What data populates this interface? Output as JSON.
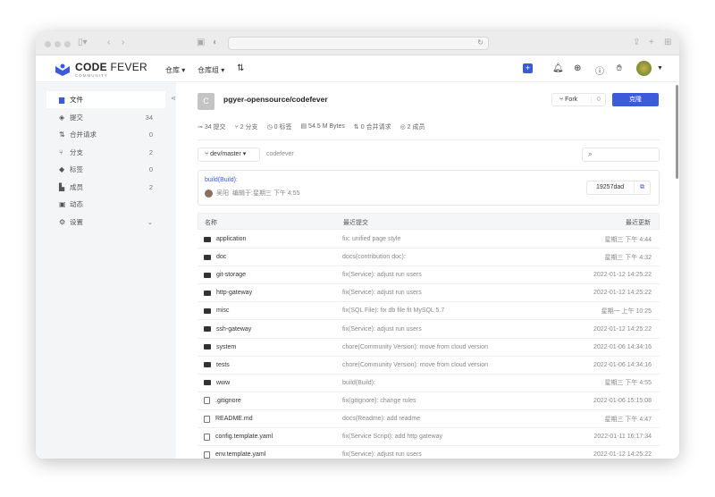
{
  "app": {
    "logo_main": "CODE",
    "logo_accent": "FEVER",
    "logo_sub": "COMMUNITY"
  },
  "header": {
    "nav": [
      {
        "label": "仓库"
      },
      {
        "label": "仓库组"
      }
    ],
    "icons": [
      "plus-icon",
      "bell-icon",
      "globe-icon",
      "help-icon",
      "hand-icon",
      "avatar"
    ]
  },
  "sidebar": {
    "items": [
      {
        "label": "文件",
        "icon": "file-icon",
        "count": ""
      },
      {
        "label": "提交",
        "icon": "commit-icon",
        "count": "34"
      },
      {
        "label": "合并请求",
        "icon": "merge-request-icon",
        "count": "0"
      },
      {
        "label": "分支",
        "icon": "branch-icon",
        "count": "2"
      },
      {
        "label": "标签",
        "icon": "tag-icon",
        "count": "0"
      },
      {
        "label": "成员",
        "icon": "members-icon",
        "count": "2"
      },
      {
        "label": "动态",
        "icon": "activity-icon",
        "count": ""
      },
      {
        "label": "设置",
        "icon": "gear-icon",
        "count": ""
      }
    ]
  },
  "repo": {
    "avatar_letter": "C",
    "name": "pgyer-opensource/codefever",
    "fork_label": "Fork",
    "fork_count": "0",
    "clone_label": "克隆",
    "stats": [
      "34 提交",
      "2 分支",
      "0 标签",
      "54.5 M Bytes",
      "0 合并请求",
      "2 成员"
    ],
    "branch": "dev/master",
    "path": "codefever",
    "last_commit": {
      "message": "build(Build):",
      "author": "吴阳",
      "meta": "编辑于:星期三 下午 4:55",
      "hash": "19257dad"
    }
  },
  "colors": {
    "accent": "#3b5bdb"
  },
  "table": {
    "headers": [
      "名称",
      "最近提交",
      "最近更新"
    ],
    "rows": [
      {
        "type": "folder",
        "name": "application",
        "commit": "fix: unified page style",
        "time": "星期三 下午 4:44"
      },
      {
        "type": "folder",
        "name": "doc",
        "commit": "docs(contribution doc):",
        "time": "星期三 下午 4:32"
      },
      {
        "type": "folder",
        "name": "git-storage",
        "commit": "fix(Service): adjust run users",
        "time": "2022-01-12 14:25:22"
      },
      {
        "type": "folder",
        "name": "http-gateway",
        "commit": "fix(Service): adjust run users",
        "time": "2022-01-12 14:25:22"
      },
      {
        "type": "folder",
        "name": "misc",
        "commit": "fix(SQL File): fix db file fit MySQL 5.7",
        "time": "星期一 上午 10:25"
      },
      {
        "type": "folder",
        "name": "ssh-gateway",
        "commit": "fix(Service): adjust run users",
        "time": "2022-01-12 14:25:22"
      },
      {
        "type": "folder",
        "name": "system",
        "commit": "chore(Community Version): move from cloud version",
        "time": "2022-01-06 14:34:16"
      },
      {
        "type": "folder",
        "name": "tests",
        "commit": "chore(Community Version): move from cloud version",
        "time": "2022-01-06 14:34:16"
      },
      {
        "type": "folder",
        "name": "www",
        "commit": "build(Build):",
        "time": "星期三 下午 4:55"
      },
      {
        "type": "file",
        "name": ".gitignore",
        "commit": "fix(gitignore): change rules",
        "time": "2022-01-06 15:15:08"
      },
      {
        "type": "file",
        "name": "README.md",
        "commit": "docs(Readme): add readme",
        "time": "星期三 下午 4:47"
      },
      {
        "type": "file",
        "name": "config.template.yaml",
        "commit": "fix(Service Script): add http gateway",
        "time": "2022-01-11 16:17:34"
      },
      {
        "type": "file",
        "name": "env.template.yaml",
        "commit": "fix(Service): adjust run users",
        "time": "2022-01-12 14:25:22"
      }
    ]
  }
}
